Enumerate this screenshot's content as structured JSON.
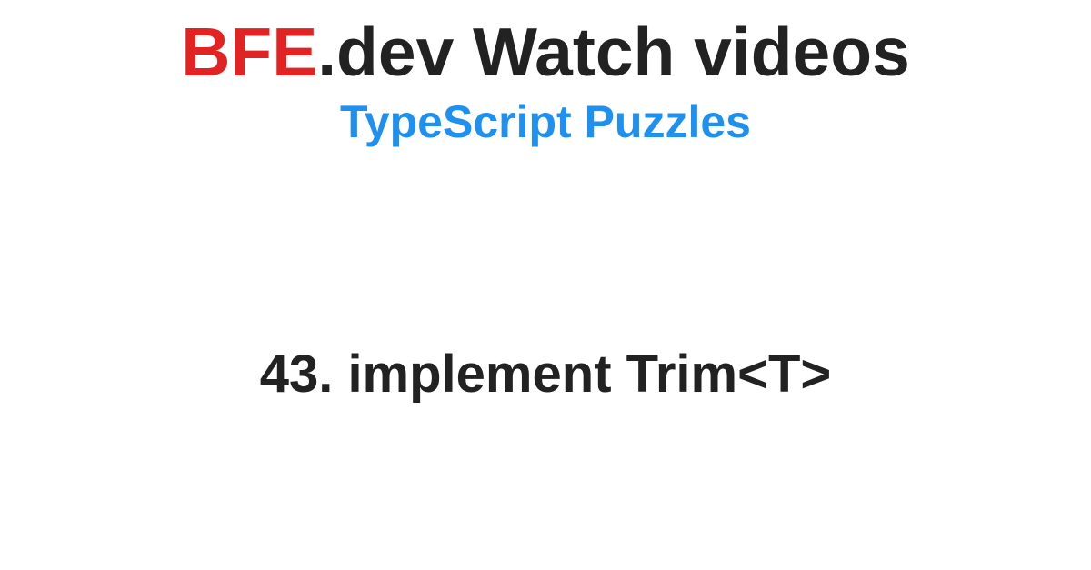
{
  "header": {
    "brand_red": "BFE",
    "brand_rest": ".dev Watch videos"
  },
  "subtitle": "TypeScript Puzzles",
  "problem": {
    "title": "43. implement Trim<T>"
  }
}
